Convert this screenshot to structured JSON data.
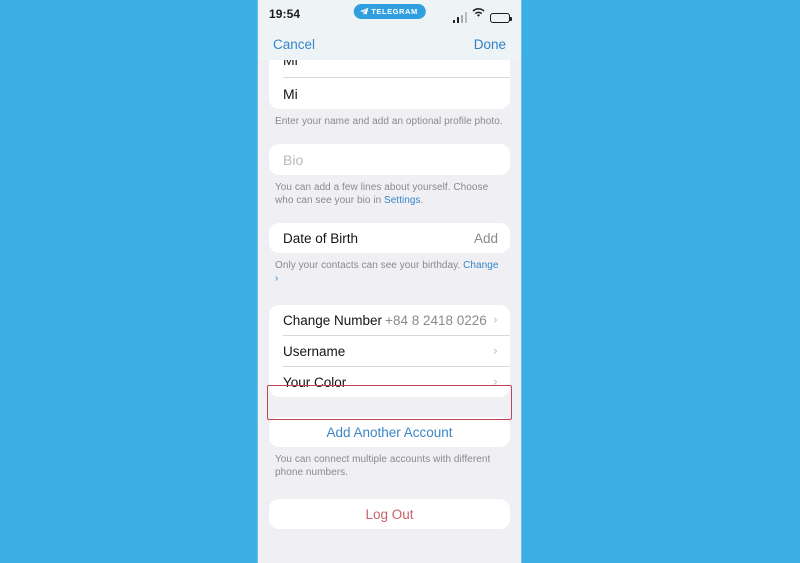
{
  "colors": {
    "page_background": "#3bafe3",
    "screen_background": "#efeff4",
    "card": "#ffffff",
    "accent_blue": "#3a86c8",
    "telegram_blue": "#2f9fe0",
    "danger_red": "#c4646a",
    "annotation_red": "#c0455a",
    "secondary_text": "#8a8a8e"
  },
  "status_bar": {
    "time": "19:54",
    "badge": {
      "icon": "paper-plane-icon",
      "label": "TELEGRAM"
    },
    "icons": {
      "signal": "cellular-signal-icon",
      "wifi": "wifi-icon",
      "battery": "battery-icon"
    }
  },
  "nav_bar": {
    "cancel_label": "Cancel",
    "done_label": "Done"
  },
  "name_section": {
    "first_name_clipped": "Mi",
    "last_name_value": "Mi",
    "footnote": "Enter your name and add an optional profile photo."
  },
  "bio_section": {
    "placeholder": "Bio",
    "value": "",
    "footnote_before": "You can add a few lines about yourself. Choose who can see your bio in ",
    "footnote_link": "Settings",
    "footnote_after": "."
  },
  "dob_section": {
    "label": "Date of Birth",
    "action": "Add",
    "footnote_before": "Only your contacts can see your birthday. ",
    "footnote_link": "Change ›"
  },
  "account_section": {
    "rows": [
      {
        "label": "Change Number",
        "value": "+84 8 2418 0226",
        "chevron": "›"
      },
      {
        "label": "Username",
        "value": "",
        "chevron": "›"
      },
      {
        "label": "Your Color",
        "value": "",
        "chevron": "›"
      }
    ]
  },
  "add_account_section": {
    "button_label": "Add Another Account",
    "footnote": "You can connect multiple accounts with different phone numbers.",
    "highlighted": true
  },
  "logout_section": {
    "button_label": "Log Out"
  }
}
